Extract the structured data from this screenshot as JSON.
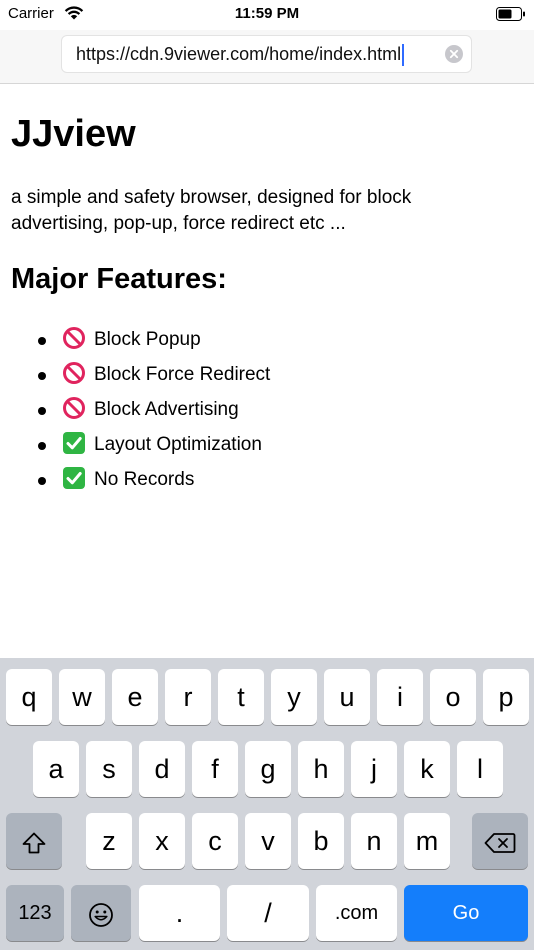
{
  "status_bar": {
    "carrier": "Carrier",
    "time": "11:59 PM"
  },
  "url_bar": {
    "value": "https://cdn.9viewer.com/home/index.html"
  },
  "page": {
    "title": "JJview",
    "description_line1": "a simple and safety browser, designed for block",
    "description_line2": "advertising, pop-up, force redirect etc ...",
    "features_heading": "Major Features:",
    "features": [
      {
        "icon": "prohibited-icon",
        "label": "Block Popup"
      },
      {
        "icon": "prohibited-icon",
        "label": "Block Force Redirect"
      },
      {
        "icon": "prohibited-icon",
        "label": "Block Advertising"
      },
      {
        "icon": "check-mark-icon",
        "label": "Layout Optimization"
      },
      {
        "icon": "check-mark-icon",
        "label": "No Records"
      }
    ]
  },
  "keyboard": {
    "row1": [
      "q",
      "w",
      "e",
      "r",
      "t",
      "y",
      "u",
      "i",
      "o",
      "p"
    ],
    "row2": [
      "a",
      "s",
      "d",
      "f",
      "g",
      "h",
      "j",
      "k",
      "l"
    ],
    "row3": [
      "z",
      "x",
      "c",
      "v",
      "b",
      "n",
      "m"
    ],
    "row4": {
      "numbers": "123",
      "dot": ".",
      "slash": "/",
      "dotcom": ".com",
      "go": "Go"
    }
  },
  "colors": {
    "go_key": "#147efb",
    "keyboard_bg": "#d1d4da",
    "prohibited_red": "#e0245e",
    "check_green": "#2fb543"
  }
}
